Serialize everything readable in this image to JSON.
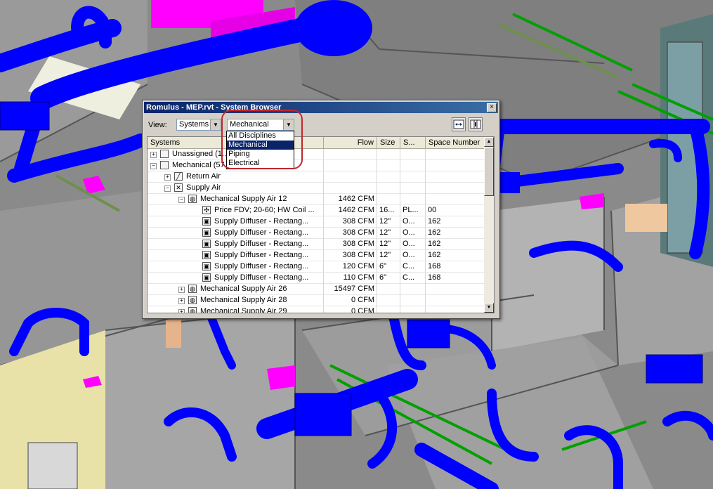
{
  "window": {
    "title": "Romulus - MEP.rvt - System Browser",
    "close_glyph": "×"
  },
  "view": {
    "label": "View:",
    "mode_value": "Systems",
    "discipline_value": "Mechanical",
    "discipline_options": [
      "All Disciplines",
      "Mechanical",
      "Piping",
      "Electrical"
    ],
    "selected_option": "Mechanical"
  },
  "toolbar": {
    "autofit_icon": "autofit-columns-icon",
    "settings_icon": "column-settings-icon"
  },
  "columns": [
    "Systems",
    "Flow",
    "Size",
    "S...",
    "Space Number"
  ],
  "rows": [
    {
      "name": "Unassigned (1...",
      "flow": "",
      "size": "",
      "s": "",
      "space": "",
      "expander": "+",
      "icon": "folder-icon"
    },
    {
      "name": "Mechanical (57...",
      "flow": "",
      "size": "",
      "s": "",
      "space": "",
      "expander": "−",
      "icon": "folder-icon"
    },
    {
      "name": "Return Air",
      "flow": "",
      "size": "",
      "s": "",
      "space": "",
      "expander": "+",
      "icon": "return-air-icon"
    },
    {
      "name": "Supply Air",
      "flow": "",
      "size": "",
      "s": "",
      "space": "",
      "expander": "−",
      "icon": "supply-air-icon"
    },
    {
      "name": "Mechanical Supply Air 12",
      "flow": "1462 CFM",
      "size": "",
      "s": "",
      "space": "",
      "expander": "−",
      "icon": "system-icon"
    },
    {
      "name": "Price FDV; 20-60; HW Coil ...",
      "flow": "1462 CFM",
      "size": "16...",
      "s": "PL...",
      "space": "00",
      "expander": "",
      "icon": "fan-icon"
    },
    {
      "name": "Supply Diffuser - Rectang...",
      "flow": "308 CFM",
      "size": "12\"",
      "s": "O...",
      "space": "162",
      "expander": "",
      "icon": "diffuser-icon"
    },
    {
      "name": "Supply Diffuser - Rectang...",
      "flow": "308 CFM",
      "size": "12\"",
      "s": "O...",
      "space": "162",
      "expander": "",
      "icon": "diffuser-icon"
    },
    {
      "name": "Supply Diffuser - Rectang...",
      "flow": "308 CFM",
      "size": "12\"",
      "s": "O...",
      "space": "162",
      "expander": "",
      "icon": "diffuser-icon"
    },
    {
      "name": "Supply Diffuser - Rectang...",
      "flow": "308 CFM",
      "size": "12\"",
      "s": "O...",
      "space": "162",
      "expander": "",
      "icon": "diffuser-icon"
    },
    {
      "name": "Supply Diffuser - Rectang...",
      "flow": "120 CFM",
      "size": "6\"",
      "s": "C...",
      "space": "168",
      "expander": "",
      "icon": "diffuser-icon"
    },
    {
      "name": "Supply Diffuser - Rectang...",
      "flow": "110 CFM",
      "size": "6\"",
      "s": "C...",
      "space": "168",
      "expander": "",
      "icon": "diffuser-icon"
    },
    {
      "name": "Mechanical Supply Air 26",
      "flow": "15497 CFM",
      "size": "",
      "s": "",
      "space": "",
      "expander": "+",
      "icon": "system-icon"
    },
    {
      "name": "Mechanical Supply Air 28",
      "flow": "0 CFM",
      "size": "",
      "s": "",
      "space": "",
      "expander": "+",
      "icon": "system-icon"
    },
    {
      "name": "Mechanical Supply Air 29",
      "flow": "0 CFM",
      "size": "",
      "s": "",
      "space": "",
      "expander": "+",
      "icon": "system-icon"
    }
  ],
  "scene_colors": {
    "duct": "#0000ff",
    "equipment": "#ff00ff",
    "pipe": "#00b000",
    "floor": "#8e8e8e",
    "wall": "#b4b4b4"
  }
}
